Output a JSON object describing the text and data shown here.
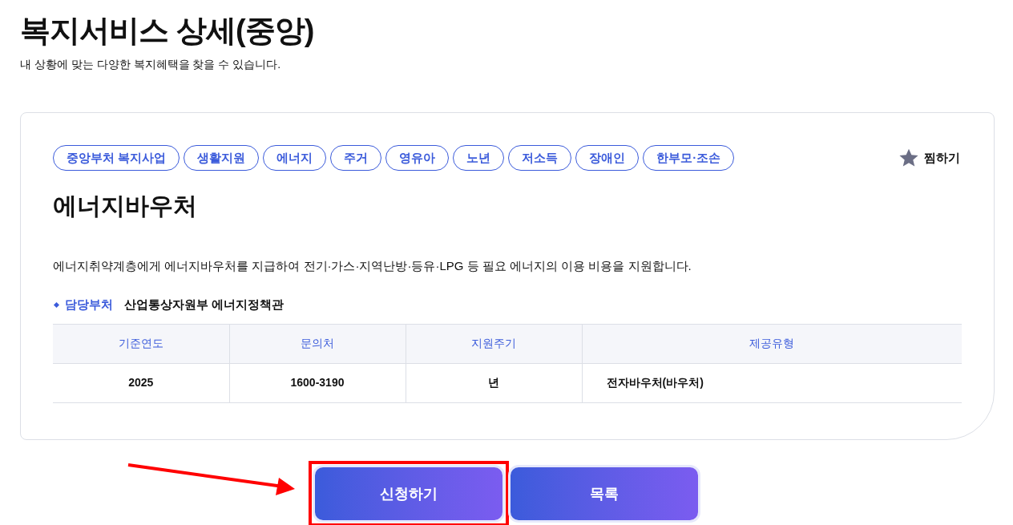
{
  "page": {
    "title": "복지서비스 상세(중앙)",
    "subtitle": "내 상황에 맞는 다양한 복지혜택을 찾을 수 있습니다."
  },
  "tags": [
    "중앙부처 복지사업",
    "생활지원",
    "에너지",
    "주거",
    "영유아",
    "노년",
    "저소득",
    "장애인",
    "한부모·조손"
  ],
  "favorite": {
    "label": "찜하기",
    "on": false
  },
  "service": {
    "name": "에너지바우처",
    "description": "에너지취약계층에게 에너지바우처를 지급하여 전기·가스·지역난방·등유·LPG 등 필요 에너지의 이용 비용을 지원합니다.",
    "department_label": "담당부처",
    "department": "산업통상자원부 에너지정책관"
  },
  "table": {
    "columns": [
      "기준연도",
      "문의처",
      "지원주기",
      "제공유형"
    ],
    "rows": [
      [
        "2025",
        "1600-3190",
        "년",
        "전자바우처(바우처)"
      ]
    ]
  },
  "buttons": [
    {
      "label": "신청하기",
      "highlighted": true
    },
    {
      "label": "목록",
      "highlighted": false
    }
  ]
}
